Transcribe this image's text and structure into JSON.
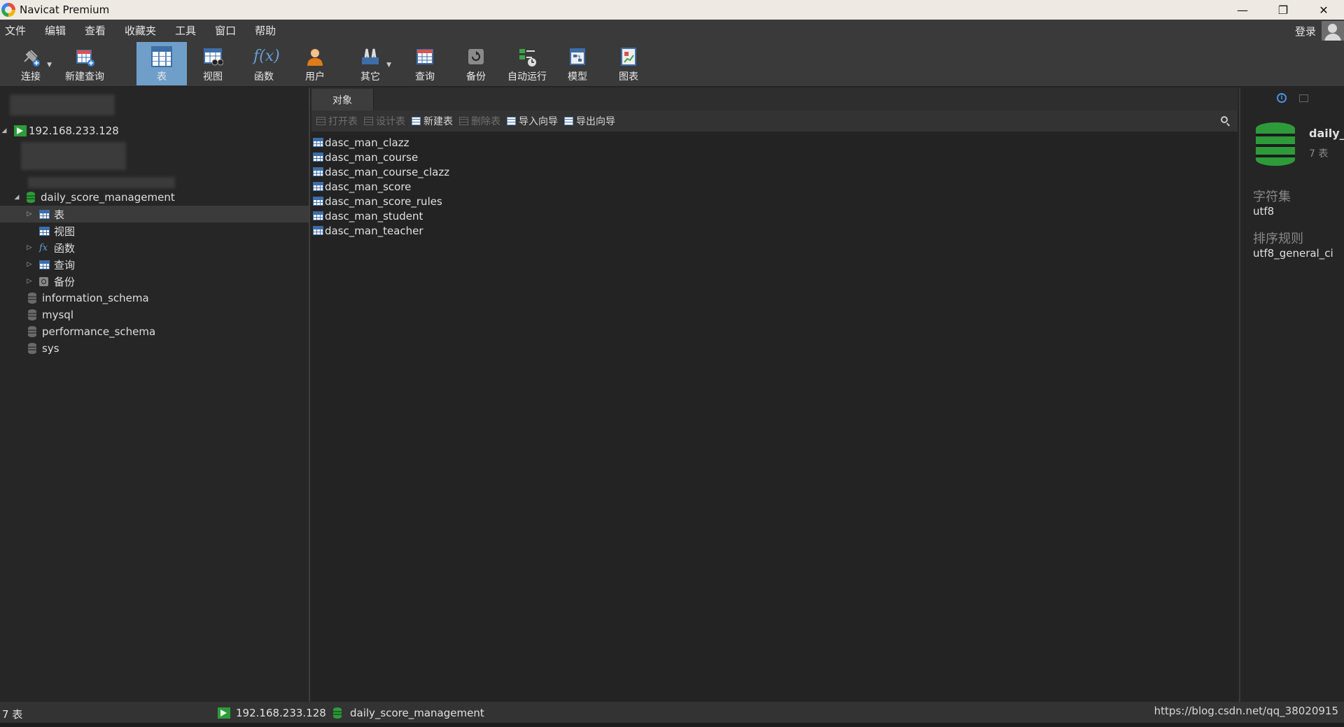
{
  "window": {
    "title": "Navicat Premium",
    "controls": [
      "minimize-icon",
      "restore-icon",
      "close-icon"
    ]
  },
  "menu": [
    "文件",
    "编辑",
    "查看",
    "收藏夹",
    "工具",
    "窗口",
    "帮助"
  ],
  "account": {
    "login_label": "登录"
  },
  "toolbar": {
    "buttons": [
      {
        "label": "连接",
        "icon": "plug-icon"
      },
      {
        "label": "新建查询",
        "icon": "new-query-icon"
      },
      {
        "label": "表",
        "icon": "table-icon",
        "active": true
      },
      {
        "label": "视图",
        "icon": "view-icon"
      },
      {
        "label": "函数",
        "icon": "function-icon"
      },
      {
        "label": "用户",
        "icon": "user-icon"
      },
      {
        "label": "其它",
        "icon": "tools-icon"
      },
      {
        "label": "查询",
        "icon": "query-icon"
      },
      {
        "label": "备份",
        "icon": "backup-icon"
      },
      {
        "label": "自动运行",
        "icon": "schedule-icon"
      },
      {
        "label": "模型",
        "icon": "model-icon"
      },
      {
        "label": "图表",
        "icon": "chart-icon"
      }
    ]
  },
  "navigator": {
    "connection": "192.168.233.128",
    "database": "daily_score_management",
    "db_children": [
      "表",
      "视图",
      "函数",
      "查询",
      "备份"
    ],
    "other_dbs": [
      "information_schema",
      "mysql",
      "performance_schema",
      "sys"
    ]
  },
  "objects": {
    "tab_label": "对象",
    "toolbar": {
      "open_table": "打开表",
      "design_table": "设计表",
      "new_table": "新建表",
      "delete_table": "删除表",
      "import_wizard": "导入向导",
      "export_wizard": "导出向导"
    },
    "tables": [
      "dasc_man_clazz",
      "dasc_man_course",
      "dasc_man_course_clazz",
      "dasc_man_score",
      "dasc_man_score_rules",
      "dasc_man_student",
      "dasc_man_teacher"
    ]
  },
  "info_panel": {
    "name": "daily_",
    "count": "7 表",
    "charset_label": "字符集",
    "charset_value": "utf8",
    "collation_label": "排序规则",
    "collation_value": "utf8_general_ci"
  },
  "status": {
    "count": "7 表",
    "connection": "192.168.233.128",
    "database": "daily_score_management",
    "watermark": "https://blog.csdn.net/qq_38020915"
  },
  "colors": {
    "accent": "#6f9fc8",
    "db_green": "#2e9b3a",
    "background": "#252525"
  }
}
